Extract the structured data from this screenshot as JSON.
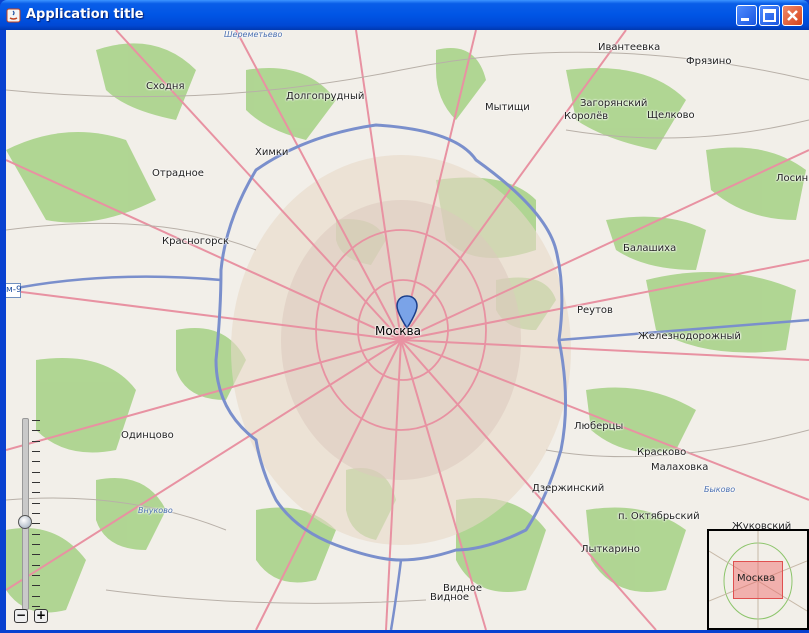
{
  "window": {
    "title": "Application title"
  },
  "map": {
    "marker_label": "Москва",
    "route_shield": "м-9",
    "places": [
      {
        "name": "Шереметьево",
        "type": "airport"
      },
      {
        "name": "Ивантеевка",
        "type": "town"
      },
      {
        "name": "Фрязино",
        "type": "town"
      },
      {
        "name": "Сходня",
        "type": "town"
      },
      {
        "name": "Долгопрудный",
        "type": "town"
      },
      {
        "name": "Мытищи",
        "type": "town"
      },
      {
        "name": "Загорянский",
        "type": "town"
      },
      {
        "name": "Королёв",
        "type": "town"
      },
      {
        "name": "Щелково",
        "type": "town"
      },
      {
        "name": "Химки",
        "type": "town"
      },
      {
        "name": "Отрадное",
        "type": "town"
      },
      {
        "name": "Лосин",
        "type": "town"
      },
      {
        "name": "Красногорск",
        "type": "town"
      },
      {
        "name": "Балашиха",
        "type": "town"
      },
      {
        "name": "Реутов",
        "type": "town"
      },
      {
        "name": "Железнодорожный",
        "type": "town"
      },
      {
        "name": "Одинцово",
        "type": "town"
      },
      {
        "name": "Люберцы",
        "type": "town"
      },
      {
        "name": "Красково",
        "type": "town"
      },
      {
        "name": "Малаховка",
        "type": "town"
      },
      {
        "name": "Внуково",
        "type": "airport"
      },
      {
        "name": "Быково",
        "type": "airport"
      },
      {
        "name": "Дзержинский",
        "type": "town"
      },
      {
        "name": "п. Октябрьский",
        "type": "town"
      },
      {
        "name": "Жуковский",
        "type": "town"
      },
      {
        "name": "Лыткарино",
        "type": "town"
      },
      {
        "name": "Видное",
        "type": "town"
      },
      {
        "name": "Видное",
        "type": "town"
      }
    ]
  },
  "zoom": {
    "in_label": "+",
    "out_label": "−",
    "level_fraction": 0.55
  },
  "minimap": {
    "label": "Москва"
  },
  "colors": {
    "titlebar": "#0055e5",
    "ring_road": "#7a8fcc",
    "forest": "#8dc56c",
    "major_road": "#e892a2",
    "minimap_view": "#f06464"
  }
}
